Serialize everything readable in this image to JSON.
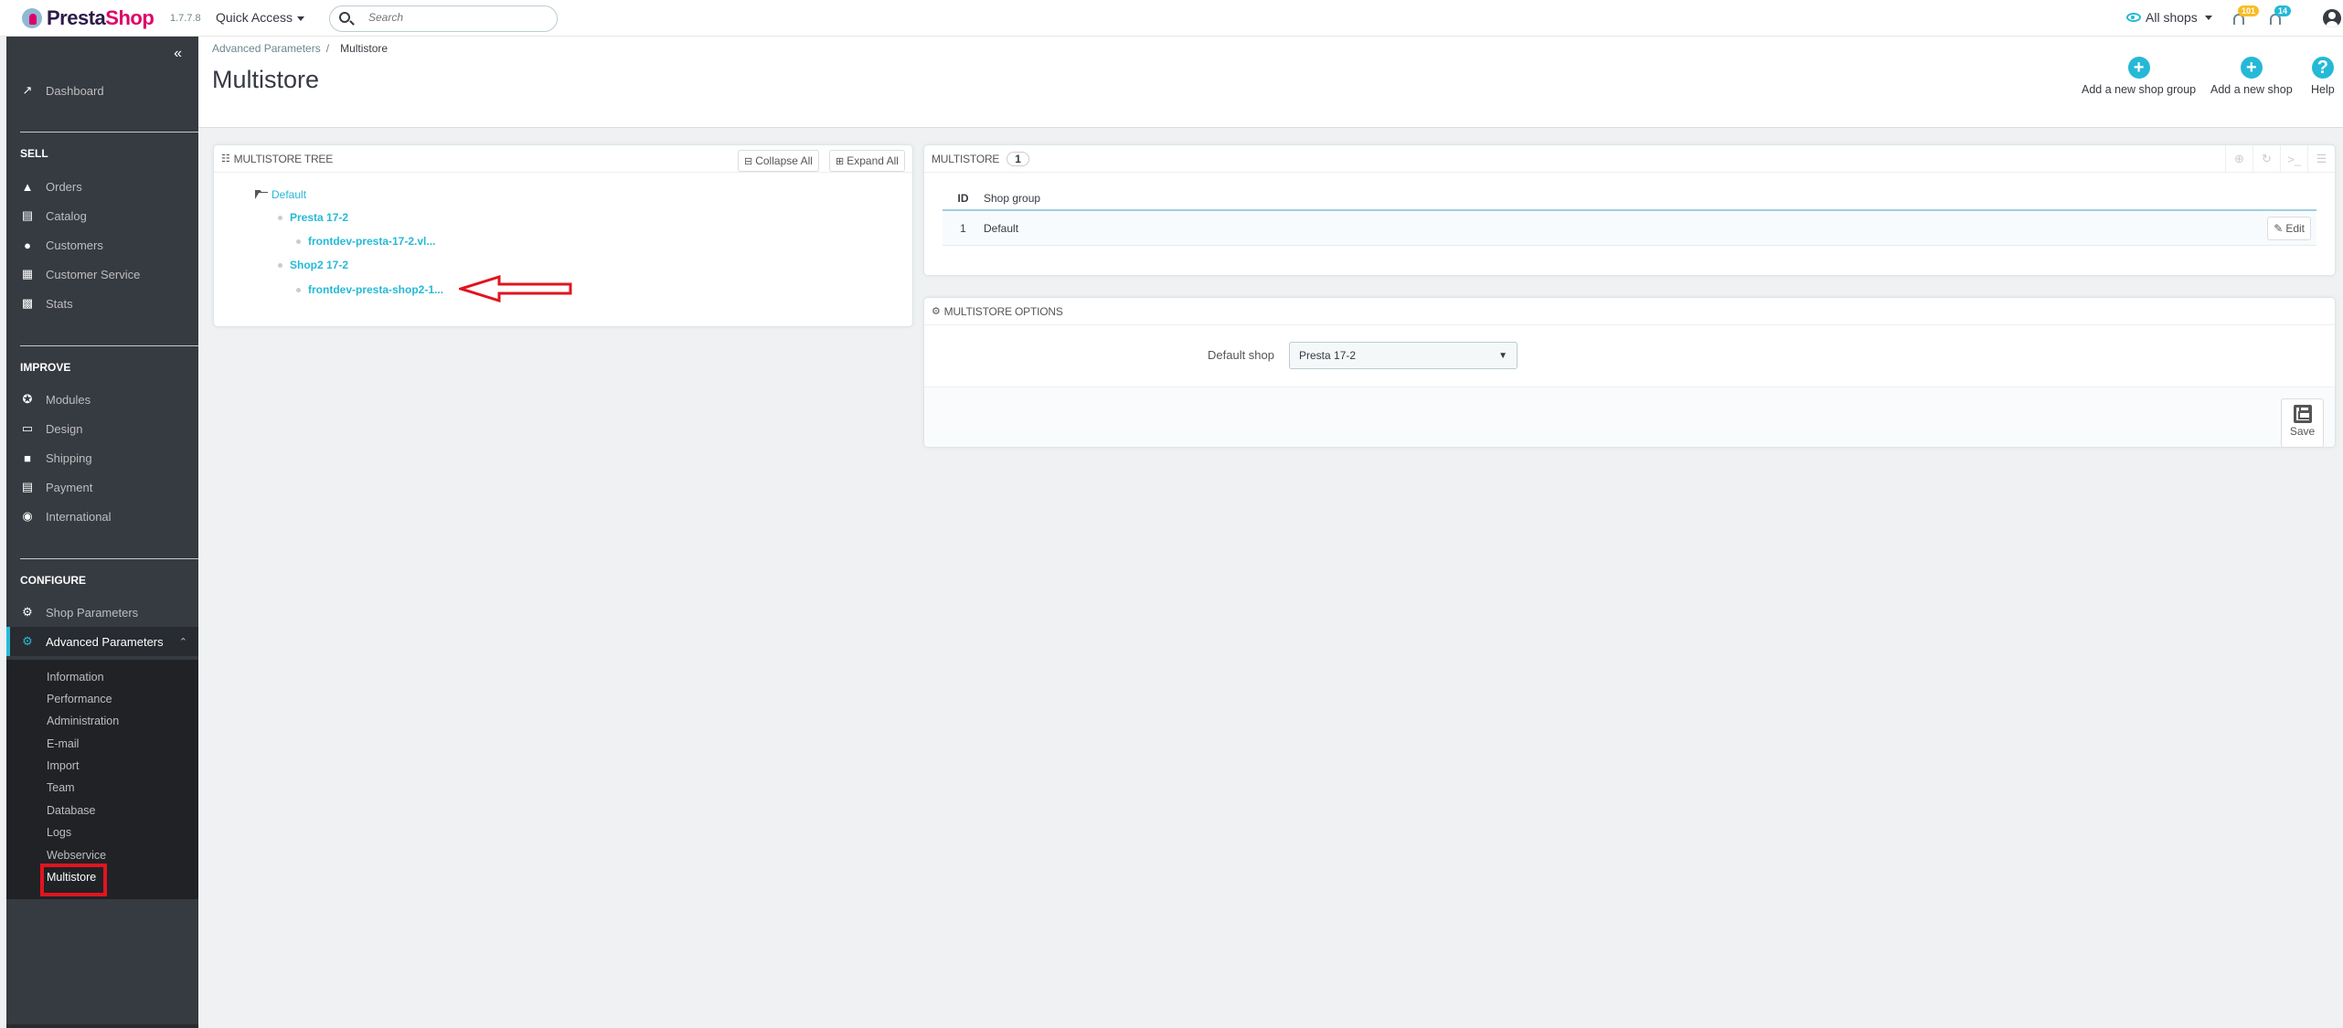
{
  "app": {
    "brand_presta": "Presta",
    "brand_shop": "Shop",
    "version": "1.7.7.8",
    "quick_access": "Quick Access",
    "search_placeholder": "Search",
    "shop_selector": "All shops",
    "notifications": {
      "orders_count": "101",
      "customers_count": "14"
    },
    "colors": {
      "accent": "#25b9d7",
      "sidebar": "#363a41",
      "brand_pink": "#df0067",
      "badge_orange": "#fbbb22",
      "highlight_red": "#e0151e"
    }
  },
  "sidebar": {
    "collapse_icon": "double-chevron-left",
    "dashboard": {
      "label": "Dashboard",
      "icon": "trending-up-icon"
    },
    "sections": [
      {
        "title": "SELL",
        "items": [
          {
            "label": "Orders",
            "icon": "basket-icon"
          },
          {
            "label": "Catalog",
            "icon": "store-icon"
          },
          {
            "label": "Customers",
            "icon": "account-circle-icon"
          },
          {
            "label": "Customer Service",
            "icon": "chat-icon"
          },
          {
            "label": "Stats",
            "icon": "bar-chart-icon"
          }
        ]
      },
      {
        "title": "IMPROVE",
        "items": [
          {
            "label": "Modules",
            "icon": "puzzle-icon"
          },
          {
            "label": "Design",
            "icon": "monitor-icon"
          },
          {
            "label": "Shipping",
            "icon": "truck-icon"
          },
          {
            "label": "Payment",
            "icon": "credit-card-icon"
          },
          {
            "label": "International",
            "icon": "globe-icon"
          }
        ]
      },
      {
        "title": "CONFIGURE",
        "items": [
          {
            "label": "Shop Parameters",
            "icon": "gear-icon"
          },
          {
            "label": "Advanced Parameters",
            "icon": "settings-app-icon"
          }
        ]
      }
    ],
    "submenu": [
      "Information",
      "Performance",
      "Administration",
      "E-mail",
      "Import",
      "Team",
      "Database",
      "Logs",
      "Webservice",
      "Multistore"
    ]
  },
  "header": {
    "breadcrumb": [
      "Advanced Parameters",
      "Multistore"
    ],
    "breadcrumb_sep": "/",
    "title": "Multistore",
    "toolbar": [
      {
        "label": "Add a new shop group",
        "icon": "plus-circle-icon"
      },
      {
        "label": "Add a new shop",
        "icon": "plus-circle-icon"
      },
      {
        "label": "Help",
        "icon": "help-circle-icon"
      }
    ]
  },
  "tree_panel": {
    "title": "Multistore tree",
    "collapse_all": "Collapse All",
    "expand_all": "Expand All",
    "root": "Default",
    "shops": [
      {
        "name": "Presta 17-2",
        "url": "frontdev-presta-17-2.vl..."
      },
      {
        "name": "Shop2 17-2",
        "url": "frontdev-presta-shop2-1..."
      }
    ]
  },
  "list_panel": {
    "title": "Multistore",
    "count": "1",
    "columns": [
      "ID",
      "Shop group"
    ],
    "rows": [
      {
        "id": "1",
        "name": "Default",
        "action": "Edit"
      }
    ]
  },
  "options_panel": {
    "title": "Multistore options",
    "default_shop_label": "Default shop",
    "default_shop_value": "Presta 17-2",
    "save_label": "Save"
  }
}
